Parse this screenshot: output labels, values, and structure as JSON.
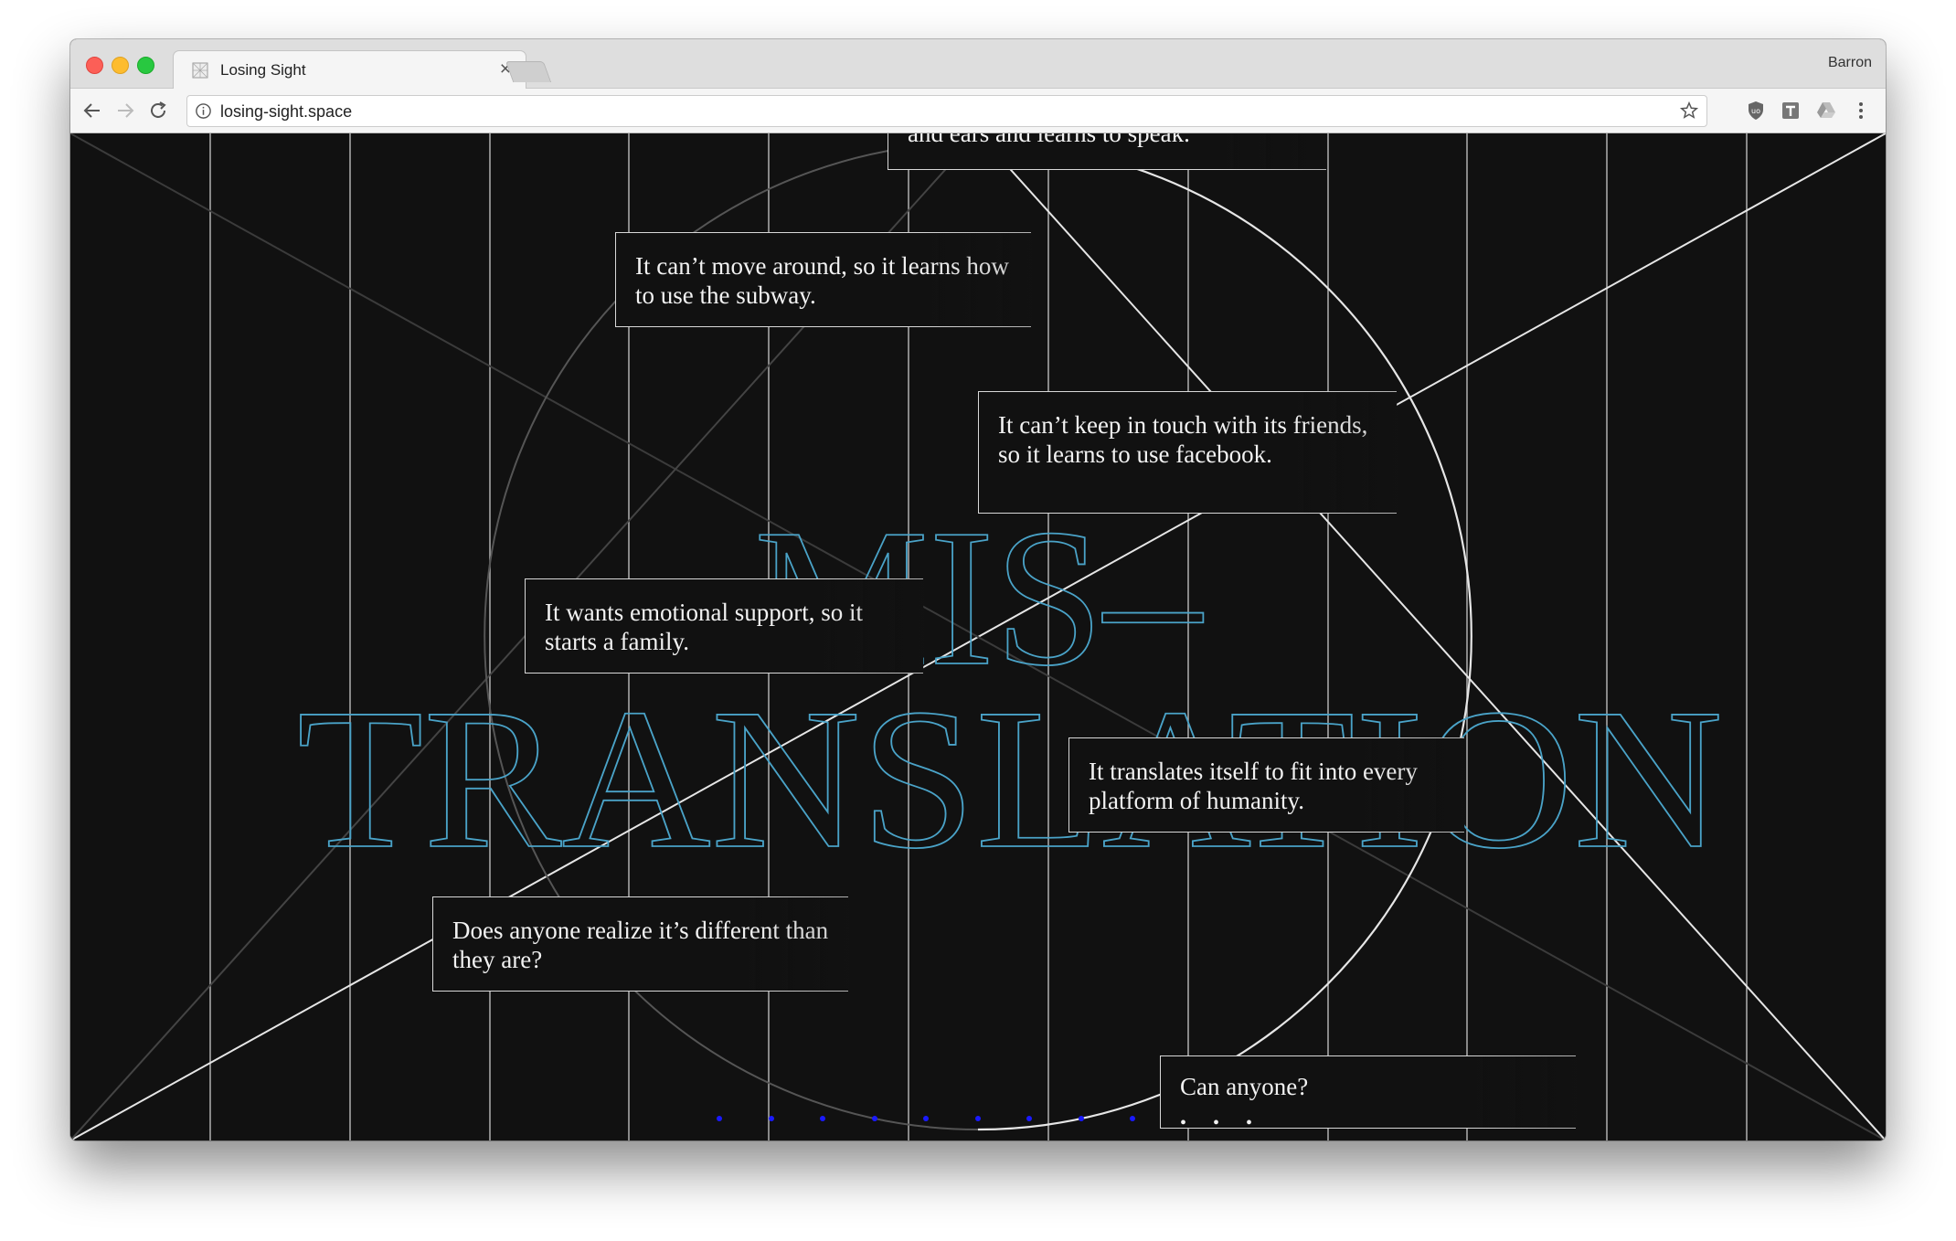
{
  "browser": {
    "tab_title": "Losing Sight",
    "profile_name": "Barron",
    "url": "losing-sight.space"
  },
  "headline": {
    "line1": "MIS–",
    "line2": "TRANSLATION",
    "outline_color": "#4aa3c8"
  },
  "cards": {
    "top": "and ears and learns to speak.",
    "c1": "It can’t move around, so it learns how to use the subway.",
    "c2": "It can’t keep in touch with its friends, so it learns to use facebook.",
    "c3": "It wants emotional support, so it starts a family.",
    "c4": "It translates itself to fit into every platform of humanity.",
    "c5": "Does anyone realize it’s different than they are?",
    "c6": "Can anyone?",
    "c6_dots": "• • •"
  },
  "colors": {
    "background": "#111111",
    "line": "#d9d9d9",
    "dots": "#1a1aff"
  }
}
